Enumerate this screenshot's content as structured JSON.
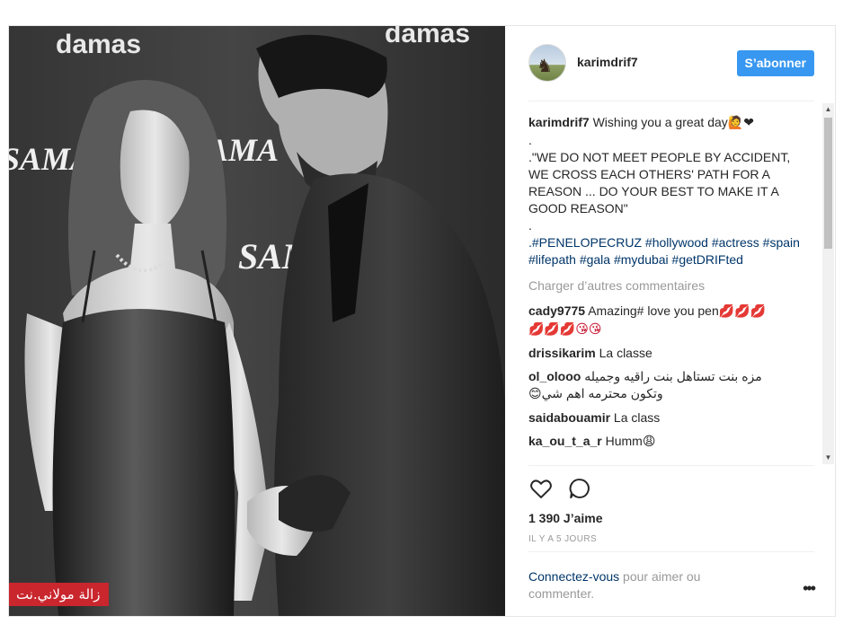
{
  "photo": {
    "brand_texts": [
      "damas",
      "damas",
      "SAMA",
      "SAMA",
      "SAMA"
    ],
    "watermark": "زالة مولاني.نت"
  },
  "header": {
    "username": "karimdrif7",
    "avatar_icon": "horse-silhouette",
    "follow_label": "S’abonner"
  },
  "caption": {
    "username": "karimdrif7",
    "text": "Wishing you a great day",
    "emoji": "🙋❤",
    "line_dot_1": ".",
    "quote": ".\"WE DO NOT MEET PEOPLE BY ACCIDENT, WE CROSS EACH OTHERS' PATH FOR A REASON ... DO YOUR BEST TO MAKE IT A GOOD REASON\"",
    "line_dot_2": ".",
    "hashtags": ".#PENELOPECRUZ #hollywood #actress #spain #lifepath #gala #mydubai #getDRIFted"
  },
  "load_more": "Charger d’autres commentaires",
  "comments": [
    {
      "user": "cady9775",
      "text": "Amazing# love you pen",
      "emoji_1": "💋💋💋",
      "emoji_2": "💋💋💋😘😘"
    },
    {
      "user": "drissikarim",
      "text": "La classe"
    },
    {
      "user": "ol_olooo",
      "text": "مزه بنت تستاهل بنت راقيه وجميله",
      "text_2": "وتكون محترمه اهم شي",
      "emoji": "😊"
    },
    {
      "user": "saidabouamir",
      "text": "La class"
    },
    {
      "user": "ka_ou_t_a_r",
      "text": "Humm",
      "emoji": "😩"
    }
  ],
  "actions": {
    "like_icon": "heart-outline-icon",
    "comment_icon": "speech-bubble-icon",
    "likes": "1 390 J’aime",
    "time": "IL Y A 5 JOURS"
  },
  "login": {
    "link": "Connectez-vous",
    "text": " pour aimer ou commenter."
  },
  "more_label": "•••",
  "colors": {
    "follow": "#3897f0",
    "hashtag": "#003569",
    "watermark_bg": "#c9262e"
  }
}
